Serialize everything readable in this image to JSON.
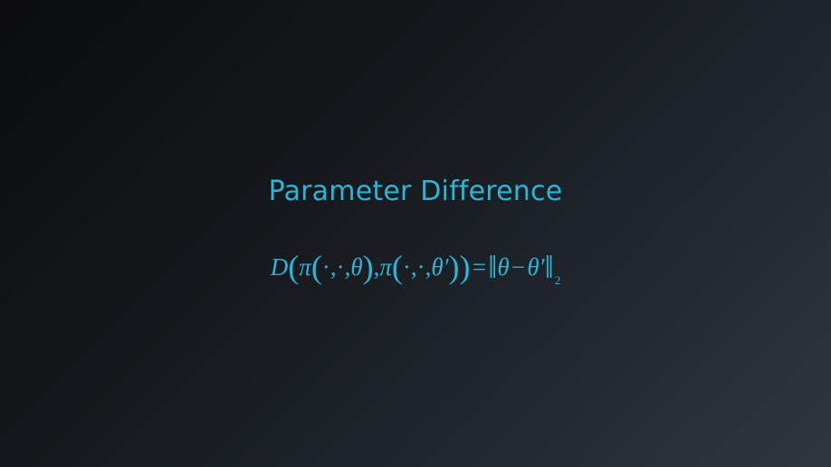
{
  "slide": {
    "title": "Parameter Difference",
    "formula": {
      "D": "D",
      "pi": "π",
      "dot": "·",
      "theta": "θ",
      "theta_prime": "θ′",
      "norm_sub": "2"
    }
  },
  "colors": {
    "accent": "#2bb6d9",
    "background_dark": "#0b0c0e",
    "background_light": "#2e3740"
  }
}
